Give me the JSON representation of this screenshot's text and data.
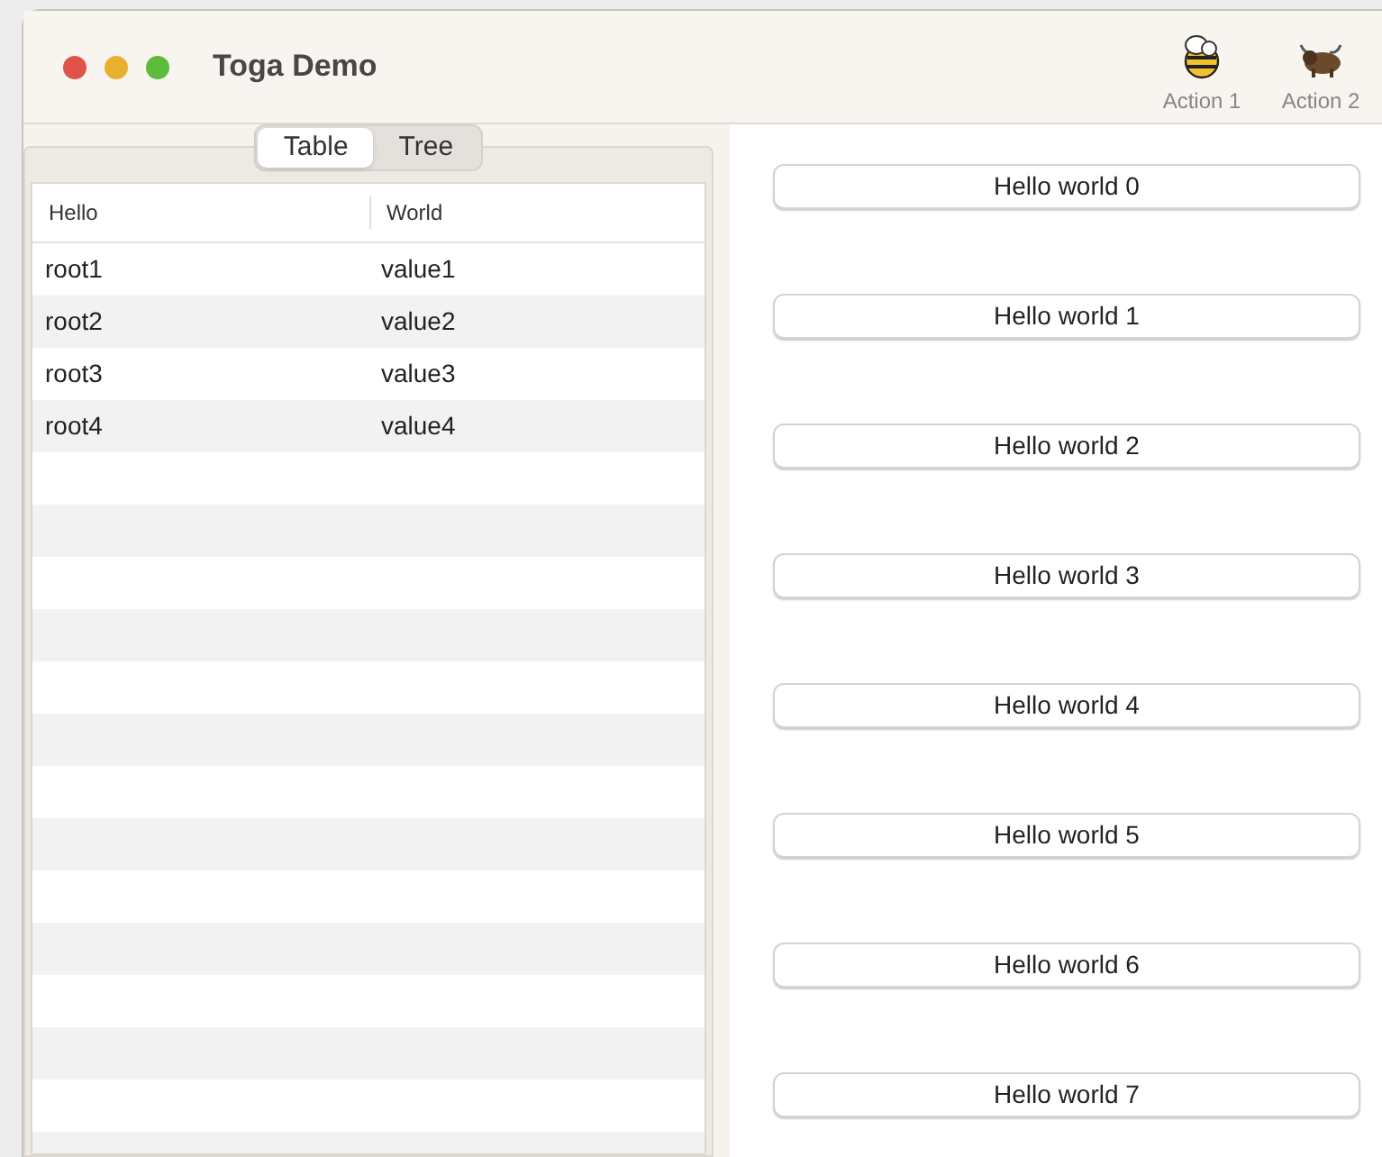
{
  "window": {
    "title": "Toga Demo"
  },
  "toolbar": [
    {
      "label": "Action 1",
      "kind": "bee"
    },
    {
      "label": "Action 2",
      "kind": "yak"
    }
  ],
  "tabs": [
    {
      "label": "Table",
      "selected": true
    },
    {
      "label": "Tree",
      "selected": false
    }
  ],
  "table": {
    "columns": [
      "Hello",
      "World"
    ],
    "rows": [
      [
        "root1",
        "value1"
      ],
      [
        "root2",
        "value2"
      ],
      [
        "root3",
        "value3"
      ],
      [
        "root4",
        "value4"
      ]
    ]
  },
  "buttons": [
    "Hello world 0",
    "Hello world 1",
    "Hello world 2",
    "Hello world 3",
    "Hello world 4",
    "Hello world 5",
    "Hello world 6",
    "Hello world 7"
  ]
}
